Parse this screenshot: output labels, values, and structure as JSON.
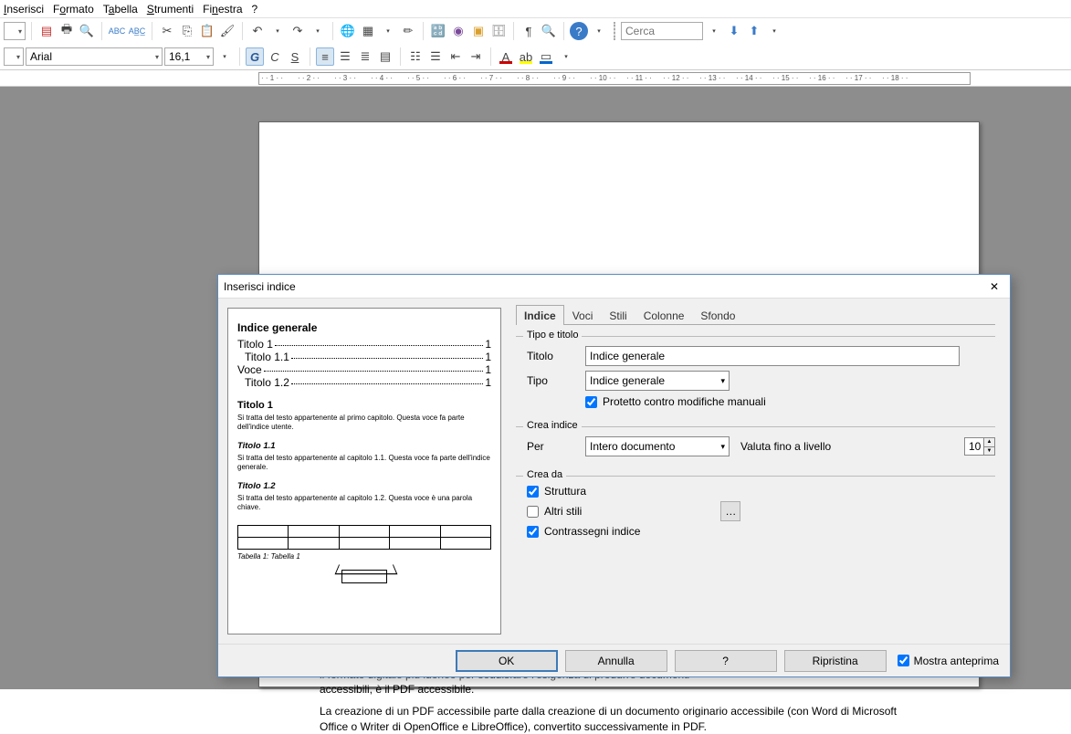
{
  "menu": {
    "insert": "Inserisci",
    "format": "Formato",
    "table": "Tabella",
    "tools": "Strumenti",
    "window": "Finestra",
    "help": "?"
  },
  "toolbar": {
    "font": "Arial",
    "size": "16,1",
    "search_placeholder": "Cerca",
    "bold": "G",
    "italic": "C",
    "underline": "S"
  },
  "dialog": {
    "title": "Inserisci indice",
    "tabs": {
      "indice": "Indice",
      "voci": "Voci",
      "stili": "Stili",
      "colonne": "Colonne",
      "sfondo": "Sfondo"
    },
    "tipo_titolo": {
      "legend": "Tipo e titolo",
      "titolo_label": "Titolo",
      "titolo_value": "Indice generale",
      "tipo_label": "Tipo",
      "tipo_value": "Indice generale",
      "protetto": "Protetto contro modifiche manuali"
    },
    "crea_indice": {
      "legend": "Crea indice",
      "per_label": "Per",
      "per_value": "Intero documento",
      "valuta": "Valuta fino a livello",
      "level": "10"
    },
    "crea_da": {
      "legend": "Crea da",
      "struttura": "Struttura",
      "altri_stili": "Altri stili",
      "contrassegni": "Contrassegni indice"
    },
    "buttons": {
      "ok": "OK",
      "annulla": "Annulla",
      "help": "?",
      "ripristina": "Ripristina",
      "mostra": "Mostra anteprima"
    }
  },
  "preview": {
    "toc_title": "Indice generale",
    "toc": [
      {
        "lbl": "Titolo 1",
        "pg": "1"
      },
      {
        "lbl": "Titolo 1.1",
        "pg": "1"
      },
      {
        "lbl": "Voce",
        "pg": "1"
      },
      {
        "lbl": "Titolo 1.2",
        "pg": "1"
      }
    ],
    "h1": "Titolo 1",
    "h1_txt": "Si tratta del testo appartenente al primo capitolo. Questa voce fa parte dell'indice utente.",
    "h11": "Titolo 1.1",
    "h11_txt": "Si tratta del testo appartenente al capitolo 1.1. Questa voce fa parte dell'indice generale.",
    "h12": "Titolo 1.2",
    "h12_txt": "Si tratta del testo appartenente al capitolo 1.2. Questa voce è una parola chiave.",
    "caption": "Tabella 1: Tabella 1"
  },
  "doc": {
    "line1": "il formato digitale più idoneo per soddisfare l'esigenza di produrre documenti",
    "line2": "accessibili, è il PDF accessibile.",
    "line3": "La creazione di un PDF accessibile parte dalla creazione di un documento originario accessibile (con Word di Microsoft Office o Writer di OpenOffice e LibreOffice), convertito successivamente in PDF."
  },
  "ruler": {
    "nums": [
      "1",
      "2",
      "3",
      "4",
      "5",
      "6",
      "7",
      "8",
      "9",
      "10",
      "11",
      "12",
      "13",
      "14",
      "15",
      "16",
      "17",
      "18"
    ]
  }
}
